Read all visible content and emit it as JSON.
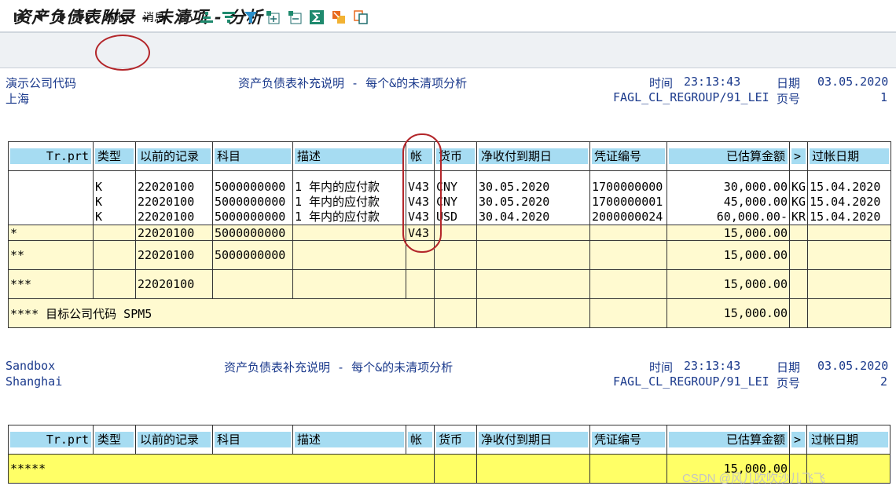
{
  "window": {
    "title": "资产负债表附录 - 未清项 - 分析"
  },
  "toolbar": {
    "post_label": "过帐",
    "msg_label": "消息",
    "icons": [
      "first-page-icon",
      "prev-page-icon",
      "next-page-icon",
      "last-page-icon",
      "glasses-icon",
      "sort-asc-icon",
      "sort-desc-icon",
      "filter-icon",
      "expand-icon",
      "collapse-icon",
      "sum-icon",
      "export-icon",
      "copy-icon"
    ]
  },
  "page1": {
    "company": "演示公司代码",
    "city": "上海",
    "report_title": "资产负债表补充说明 - 每个&的未清项分析",
    "time_label": "时间",
    "time_value": "23:13:43",
    "date_label": "日期",
    "date_value": "03.05.2020",
    "program": "FAGL_CL_REGROUP/91_LEI",
    "page_label": "页号",
    "page_no": "1"
  },
  "page2": {
    "company": "Sandbox",
    "city": "Shanghai",
    "report_title": "资产负债表补充说明 - 每个&的未清项分析",
    "time_label": "时间",
    "time_value": "23:13:43",
    "date_label": "日期",
    "date_value": "03.05.2020",
    "program": "FAGL_CL_REGROUP/91_LEI",
    "page_label": "页号",
    "page_no": "2"
  },
  "columns": [
    "Tr.prt",
    "类型",
    "以前的记录",
    "科目",
    "描述",
    "帐",
    "货币",
    "净收付到期日",
    "凭证编号",
    "已估算金额",
    ">",
    "过帐日期"
  ],
  "detail_rows": [
    {
      "type": "K",
      "prev": "22020100",
      "acct": "5000000000",
      "desc": "1 年内的应付款",
      "ledger": "V43",
      "cur": "CNY",
      "due": "30.05.2020",
      "doc": "1700000000",
      "amt": "30,000.00",
      "flag": "KG",
      "post": "15.04.2020"
    },
    {
      "type": "K",
      "prev": "22020100",
      "acct": "5000000000",
      "desc": "1 年内的应付款",
      "ledger": "V43",
      "cur": "CNY",
      "due": "30.05.2020",
      "doc": "1700000001",
      "amt": "45,000.00",
      "flag": "KG",
      "post": "15.04.2020"
    },
    {
      "type": "K",
      "prev": "22020100",
      "acct": "5000000000",
      "desc": "1 年内的应付款",
      "ledger": "V43",
      "cur": "USD",
      "due": "30.04.2020",
      "doc": "2000000024",
      "amt": "60,000.00-",
      "flag": "KR",
      "post": "15.04.2020"
    }
  ],
  "sub1": {
    "marker": "*",
    "prev": "22020100",
    "acct": "5000000000",
    "ledger": "V43",
    "amt": "15,000.00"
  },
  "sub2": {
    "marker": "**",
    "prev": "22020100",
    "acct": "5000000000",
    "amt": "15,000.00"
  },
  "sub3": {
    "marker": "***",
    "prev": "22020100",
    "amt": "15,000.00"
  },
  "sub4": {
    "label": "**** 目标公司代码 SPM5",
    "amt": "15,000.00"
  },
  "total": {
    "marker": "*****",
    "amt": "15,000.00"
  },
  "watermark": "CSDN @风儿吹吹沙儿飞飞"
}
